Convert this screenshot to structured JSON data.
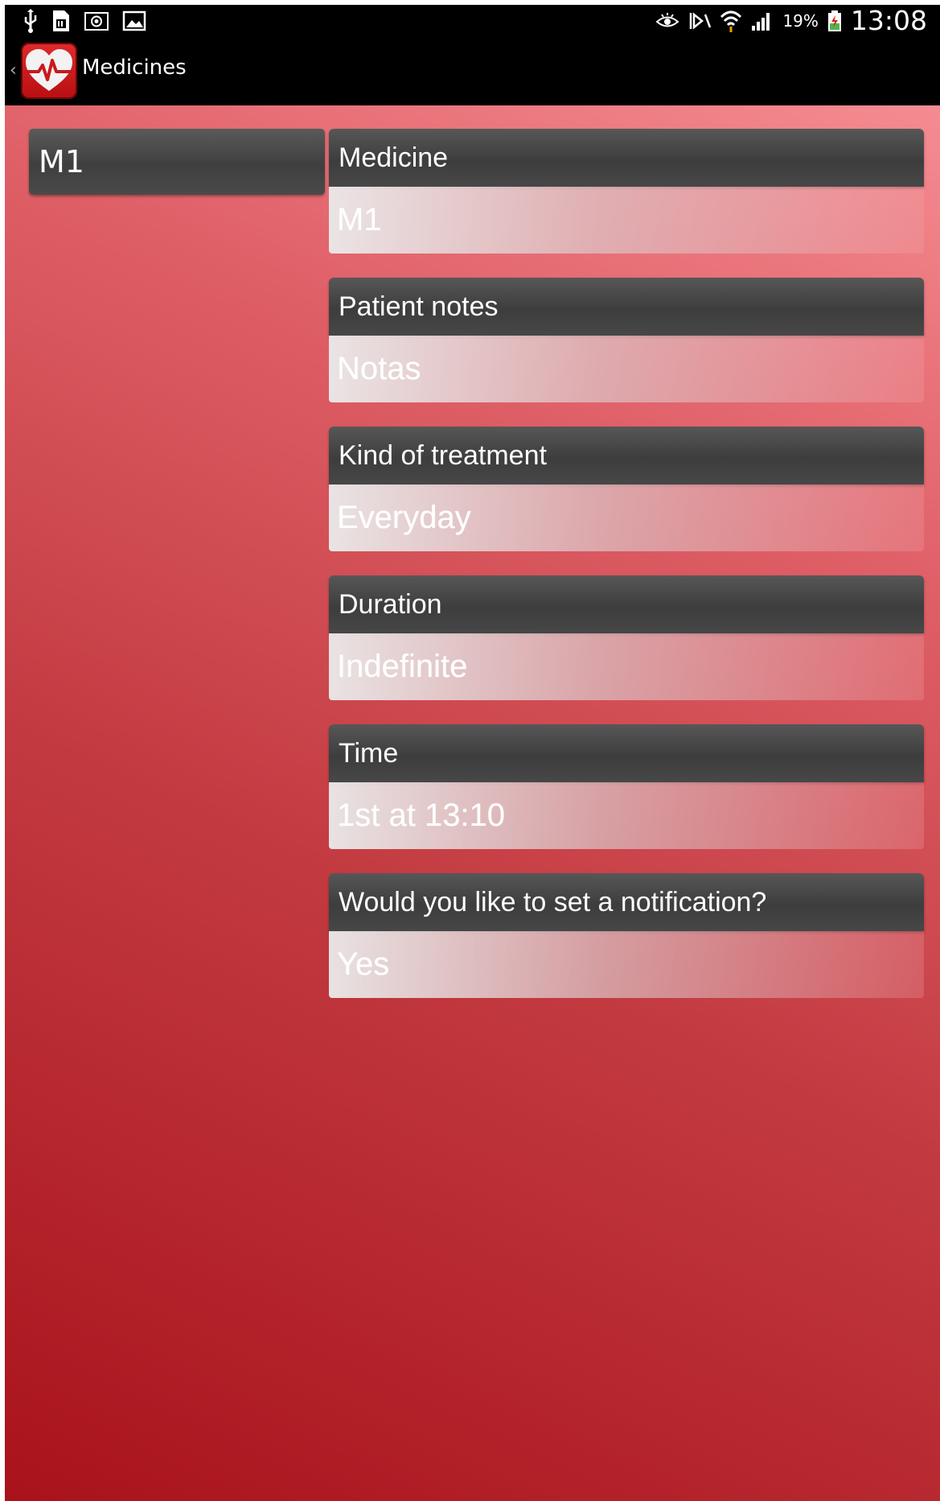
{
  "status_bar": {
    "left_icons": [
      "usb-icon",
      "sim-card-icon",
      "screenshot-icon",
      "gallery-icon"
    ],
    "right_icons": [
      "eye-icon",
      "mute-icon",
      "wifi-icon",
      "signal-icon",
      "battery-icon"
    ],
    "battery_percent": "19%",
    "time": "13:08"
  },
  "action_bar": {
    "title": "Medicines",
    "icon": "heart-pulse-icon",
    "up_caret": "‹"
  },
  "medicine_list": [
    {
      "name": "M1"
    }
  ],
  "detail_fields": [
    {
      "label": "Medicine",
      "value": "M1"
    },
    {
      "label": "Patient notes",
      "value": "Notas"
    },
    {
      "label": "Kind of treatment",
      "value": "Everyday"
    },
    {
      "label": "Duration",
      "value": "Indefinite"
    },
    {
      "label": "Time",
      "value": "1st at 13:10"
    },
    {
      "label": "Would you like to set a notification?",
      "value": "Yes"
    }
  ],
  "colors": {
    "background_dark": "#a9121b",
    "background_light": "#f9959a",
    "bar": "#000000",
    "label_bg": "#474747"
  }
}
